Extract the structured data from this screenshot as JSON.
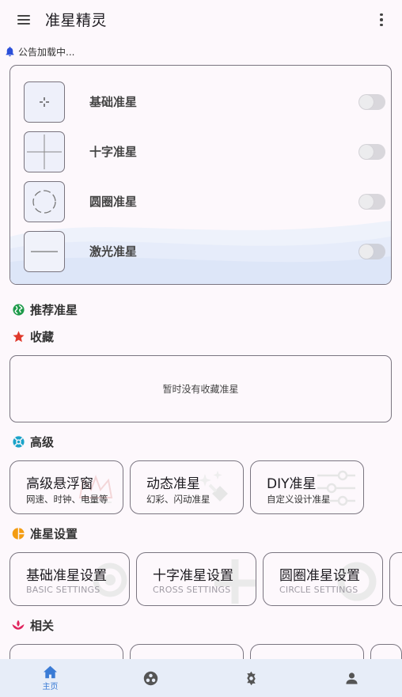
{
  "app": {
    "title": "准星精灵",
    "menu_icon": "hamburger-menu-icon",
    "more_icon": "more-vert-icon"
  },
  "notice": {
    "icon": "bell-icon",
    "text": "公告加载中...",
    "icon_color": "#2b4fd9"
  },
  "crosshairs": [
    {
      "label": "基础准星",
      "icon": "dot-crosshair-icon",
      "enabled": false
    },
    {
      "label": "十字准星",
      "icon": "cross-crosshair-icon",
      "enabled": false
    },
    {
      "label": "圆圈准星",
      "icon": "circle-crosshair-icon",
      "enabled": false
    },
    {
      "label": "激光准星",
      "icon": "laser-line-icon",
      "enabled": false
    }
  ],
  "sections": {
    "recommended": {
      "label": "推荐准星",
      "icon": "globe-icon",
      "color": "#1e9a4a"
    },
    "favorites": {
      "label": "收藏",
      "icon": "star-icon",
      "color": "#e0392b",
      "empty_text": "暂时没有收藏准星"
    },
    "advanced": {
      "label": "高级",
      "icon": "lifebuoy-icon",
      "color": "#1aa3c9"
    },
    "settings": {
      "label": "准星设置",
      "icon": "pie-icon",
      "color": "#f39c12"
    },
    "related": {
      "label": "相关",
      "icon": "lotus-icon",
      "color": "#e0245e"
    }
  },
  "advanced_tiles": [
    {
      "title": "高级悬浮窗",
      "subtitle": "网速、时钟、电量等",
      "icon": "crown-icon"
    },
    {
      "title": "动态准星",
      "subtitle": "幻彩、闪动准星",
      "icon": "magic-wand-icon"
    },
    {
      "title": "DIY准星",
      "subtitle": "自定义设计准星",
      "icon": "sliders-icon"
    }
  ],
  "settings_tiles": [
    {
      "title": "基础准星设置",
      "subtitle": "BASIC SETTINGS",
      "icon": "dot-target-icon"
    },
    {
      "title": "十字准星设置",
      "subtitle": "CROSS SETTINGS",
      "icon": "plus-icon"
    },
    {
      "title": "圆圈准星设置",
      "subtitle": "CIRCLE SETTINGS",
      "icon": "ring-icon"
    }
  ],
  "bottom_nav": [
    {
      "label": "主页",
      "icon": "home-icon",
      "active": true
    },
    {
      "label": "",
      "icon": "community-icon",
      "active": false
    },
    {
      "label": "",
      "icon": "settings-gear-icon",
      "active": false
    },
    {
      "label": "",
      "icon": "person-icon",
      "active": false
    }
  ],
  "colors": {
    "accent": "#3a7bd5",
    "nav_bg": "#e7edf8",
    "background": "#fdf8fc"
  }
}
